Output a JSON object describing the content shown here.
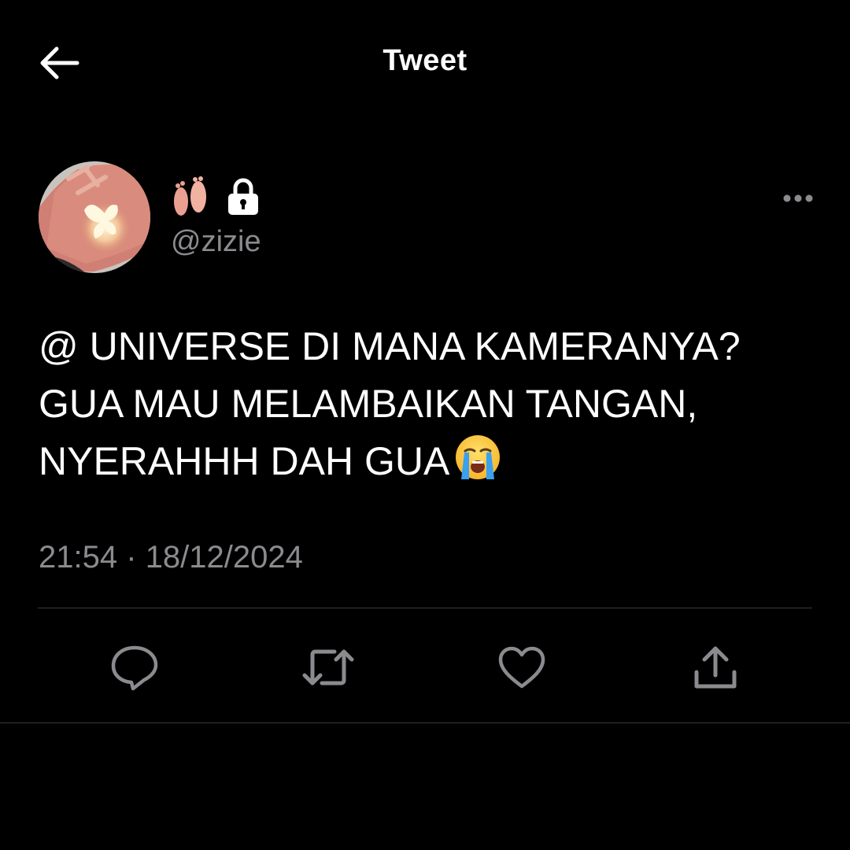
{
  "header": {
    "title": "Tweet",
    "back_icon": "arrow-left-icon"
  },
  "user": {
    "display_name_icons": [
      "feet-emoji-icon",
      "lock-icon"
    ],
    "handle": "@zizie"
  },
  "tweet": {
    "lines": [
      "@ UNIVERSE DI MANA KAMERANYA?",
      "GUA MAU MELAMBAIKAN TANGAN,",
      "NYERAHHH DAH GUA"
    ],
    "emoji": "loudly-crying-face-emoji",
    "time": "21:54",
    "separator": "·",
    "date": "18/12/2024"
  },
  "actions": [
    "reply-icon",
    "retweet-icon",
    "like-icon",
    "share-icon"
  ],
  "colors": {
    "background": "#000000",
    "text": "#ffffff",
    "secondary": "#8b8b8f",
    "divider": "#3a3a3c"
  }
}
